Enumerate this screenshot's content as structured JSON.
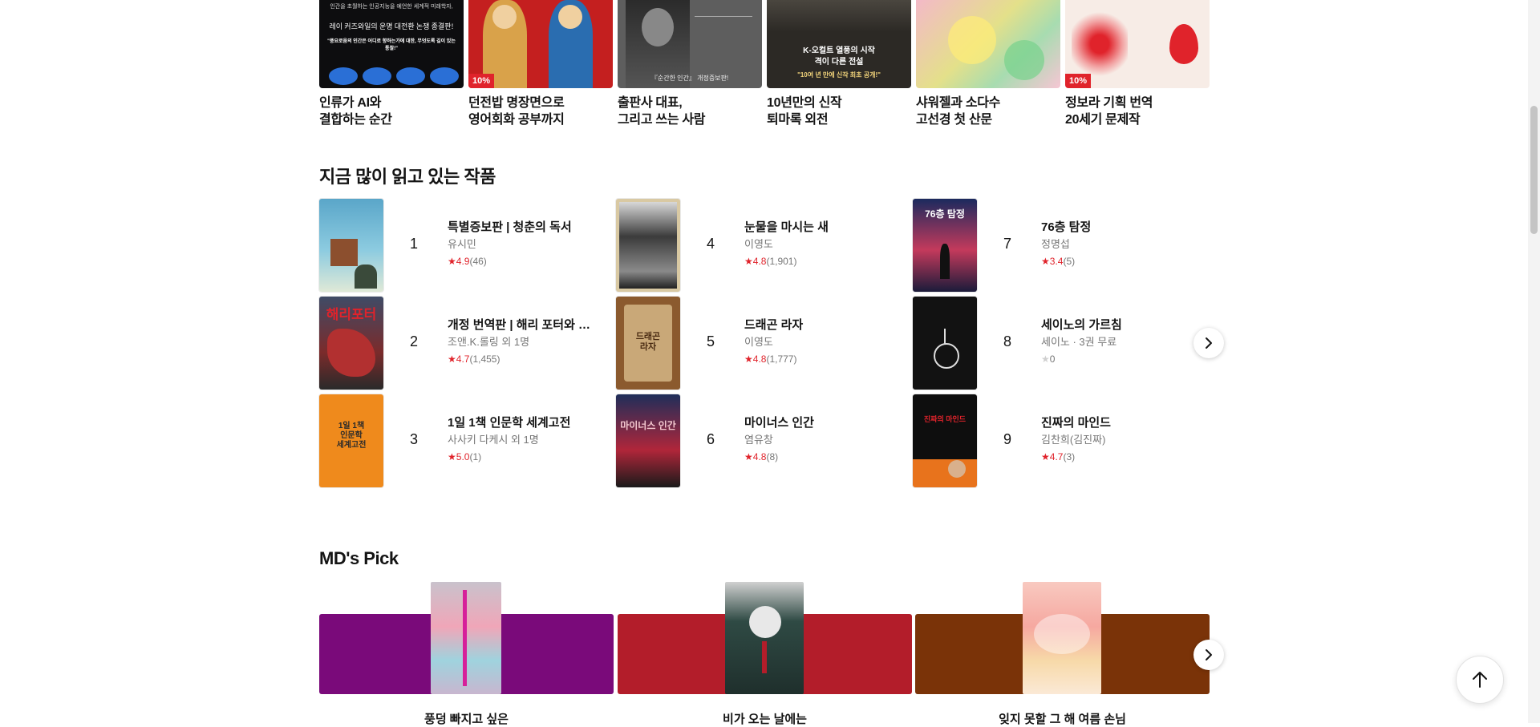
{
  "banners": [
    {
      "title": "인류가 AI와\n결합하는 순간",
      "badge": "",
      "cover_text": [
        "인간을 초월하는 인공지능을 예언한 세계적 미래학자,",
        "레이 커즈와일의 운명 대전환 논쟁 종결판!",
        "\"풍요로움의 인간은 어디로 향하는가에 대한, 무엇도록 길이 있는 통찰!\""
      ]
    },
    {
      "title": "던전밥 명장면으로\n영어회화 공부까지",
      "badge": "10%",
      "cover_text": []
    },
    {
      "title": "출판사 대표,\n그리고 쓰는 사람",
      "badge": "",
      "cover_text": [
        "『순간한 인간』 개정증보판!"
      ]
    },
    {
      "title": "10년만의 신작\n퇴마록 외전",
      "badge": "",
      "cover_text": [
        "K-오컬트 열풍의 시작",
        "격이 다른 전설",
        "\"10여 년 만에 신작 최초 공개!\""
      ]
    },
    {
      "title": "샤워젤과 소다수\n고선경 첫 산문",
      "badge": "",
      "cover_text": []
    },
    {
      "title": "정보라 기획 번역\n20세기 문제작",
      "badge": "10%",
      "cover_text": []
    }
  ],
  "popular": {
    "title": "지금 많이 읽고 있는 작품",
    "items": [
      {
        "rank": "1",
        "title": "특별증보판 | 청춘의 독서",
        "author": "유시민",
        "score": "4.9",
        "count": "(46)",
        "rated": true
      },
      {
        "rank": "2",
        "title": "개정 번역판 | 해리 포터와 마법사의 돌",
        "author": "조앤.K.롤링 외 1명",
        "score": "4.7",
        "count": "(1,455)",
        "rated": true
      },
      {
        "rank": "3",
        "title": "1일 1책 인문학 세계고전",
        "author": "사사키 다케시 외 1명",
        "score": "5.0",
        "count": "(1)",
        "rated": true
      },
      {
        "rank": "4",
        "title": "눈물을 마시는 새",
        "author": "이영도",
        "score": "4.8",
        "count": "(1,901)",
        "rated": true
      },
      {
        "rank": "5",
        "title": "드래곤 라자",
        "author": "이영도",
        "score": "4.8",
        "count": "(1,777)",
        "rated": true
      },
      {
        "rank": "6",
        "title": "마이너스 인간",
        "author": "염유창",
        "score": "4.8",
        "count": "(8)",
        "rated": true
      },
      {
        "rank": "7",
        "title": "76층 탐정",
        "author": "정명섭",
        "score": "3.4",
        "count": "(5)",
        "rated": true
      },
      {
        "rank": "8",
        "title": "세이노의 가르침",
        "author": "세이노 · 3권 무료",
        "score": "0",
        "count": "",
        "rated": false
      },
      {
        "rank": "9",
        "title": "진짜의 마인드",
        "author": "김찬희(김진짜)",
        "score": "4.7",
        "count": "(3)",
        "rated": true
      }
    ],
    "cover_text": {
      "c2": "해리포터",
      "c3": "1일 1책\n인문학\n세계고전",
      "c5": "드래곤\n라자",
      "c6": "마이너스 인간",
      "c7": "76층 탐정",
      "c9": "진짜의 마인드"
    }
  },
  "md_pick": {
    "title": "MD's Pick",
    "items": [
      {
        "caption": "풍덩 빠지고 싶은",
        "color": "#7a0a7a"
      },
      {
        "caption": "비가 오는 날에는",
        "color": "#b31d2a"
      },
      {
        "caption": "잊지 못할 그 해 여름 손님",
        "color": "#7a3308"
      }
    ]
  },
  "icons": {
    "next": "chevron-right-icon",
    "top": "arrow-up-icon",
    "star": "star-icon"
  },
  "colors": {
    "accent": "#e0232b",
    "text": "#141414",
    "muted": "#767676"
  }
}
